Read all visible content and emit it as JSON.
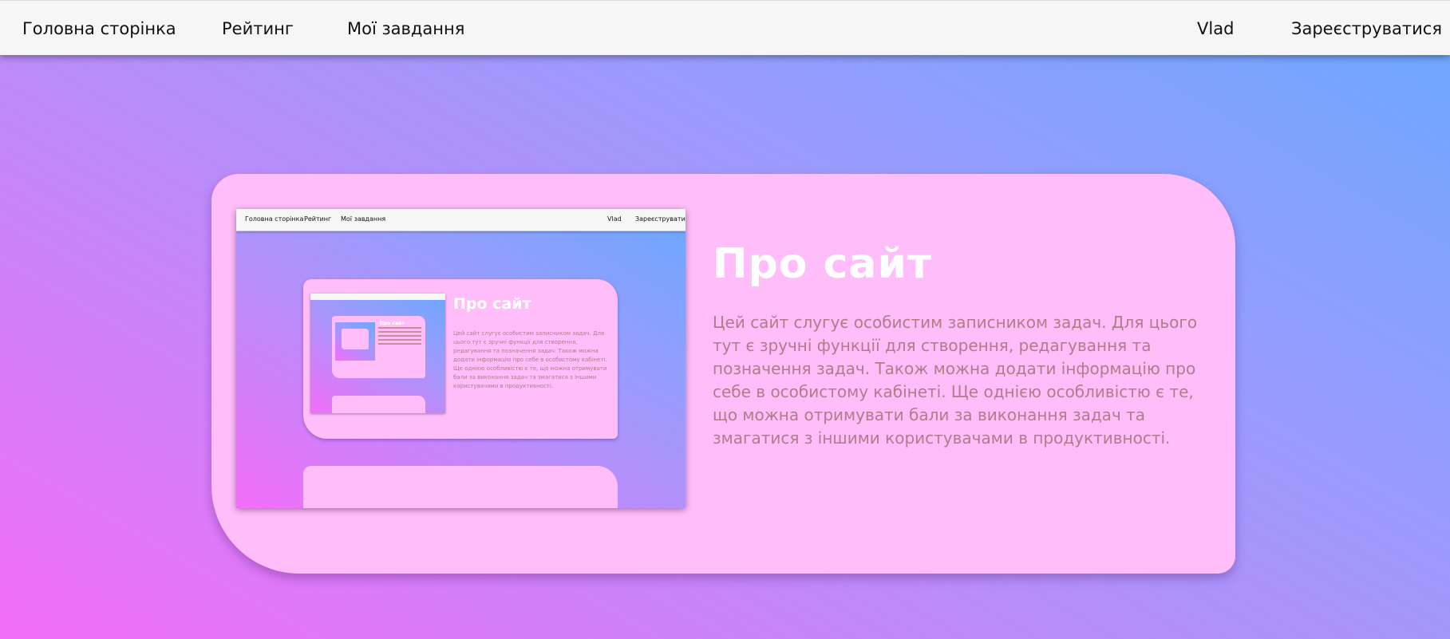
{
  "nav": {
    "home": "Головна сторінка",
    "rating": "Рейтинг",
    "tasks": "Мої завдання",
    "user": "Vlad",
    "register": "Зареєструватися"
  },
  "about": {
    "title": "Про сайт",
    "text": "Цей сайт слугує особистим записником задач. Для цього тут є зручні функції для створення, редагування та позначення задач. Також можна додати інформацію про себе в особистому кабінеті. Ще однією особливістю є те, що можна отримувати бали за виконання задач та змагатися з іншими користувачами в продуктивності."
  },
  "colors": {
    "card": "#ffbefa",
    "title": "#ffffff",
    "text": "#b57a8a",
    "gradient_start": "#f36ef9",
    "gradient_end": "#6aa8fd"
  }
}
